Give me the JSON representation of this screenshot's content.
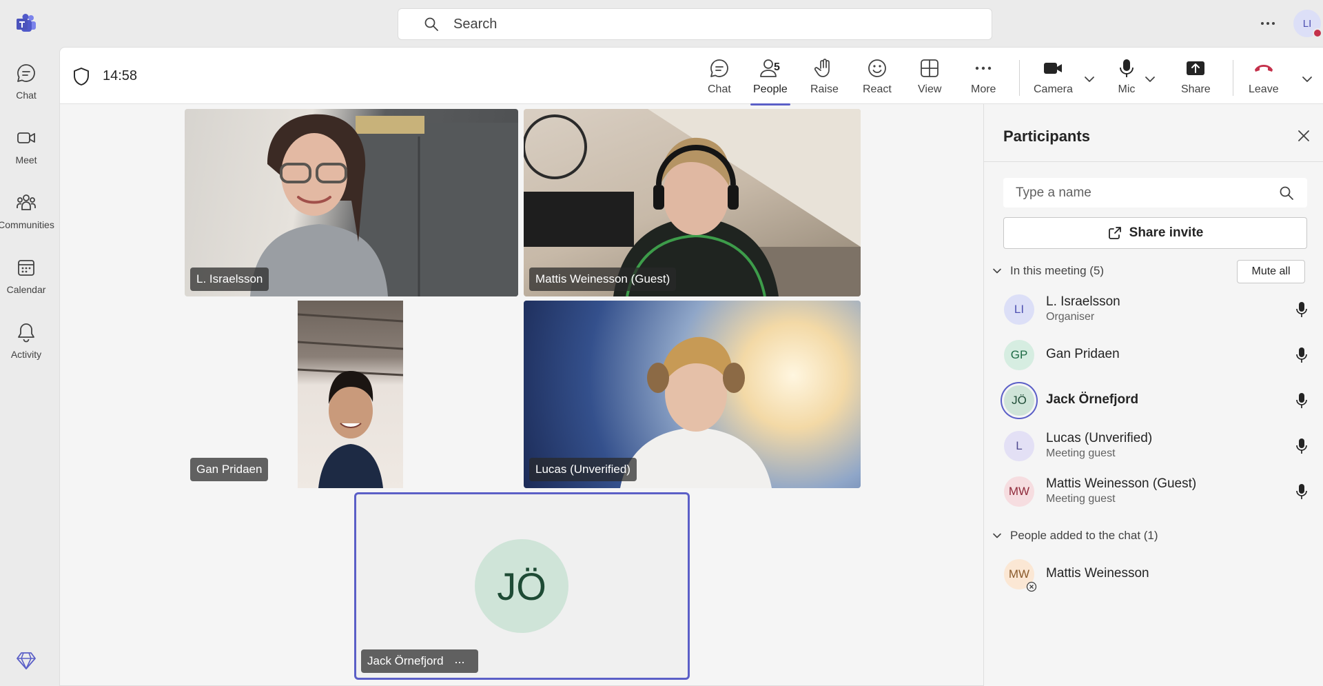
{
  "app": {
    "name": "Microsoft Teams"
  },
  "search": {
    "placeholder": "Search"
  },
  "user": {
    "initials": "LI",
    "status_color": "#c4314b"
  },
  "rail": {
    "items": [
      {
        "label": "Chat",
        "icon": "chat-icon"
      },
      {
        "label": "Meet",
        "icon": "video-camera-icon"
      },
      {
        "label": "Communities",
        "icon": "communities-icon"
      },
      {
        "label": "Calendar",
        "icon": "calendar-icon"
      },
      {
        "label": "Activity",
        "icon": "bell-icon"
      }
    ],
    "bottom_icon": "premium-diamond-icon"
  },
  "meeting": {
    "timer": "14:58",
    "toolbar": {
      "chat": "Chat",
      "people": "People",
      "people_count": "5",
      "raise": "Raise",
      "react": "React",
      "view": "View",
      "more": "More",
      "camera": "Camera",
      "mic": "Mic",
      "share": "Share",
      "leave": "Leave"
    },
    "accent_color": "#5b5fc7",
    "leave_color": "#c4314b",
    "tiles": [
      {
        "name": "L. Israelsson"
      },
      {
        "name": "Mattis Weinesson (Guest)"
      },
      {
        "name": "Gan Pridaen"
      },
      {
        "name": "Lucas (Unverified)"
      },
      {
        "name": "Jack Örnefjord",
        "initials": "JÖ",
        "more": "···"
      }
    ]
  },
  "panel": {
    "title": "Participants",
    "search_placeholder": "Type a name",
    "share_invite": "Share invite",
    "in_meeting_label": "In this meeting (5)",
    "mute_all": "Mute all",
    "participants": [
      {
        "initials": "LI",
        "name": "L. Israelsson",
        "role": "Organiser"
      },
      {
        "initials": "GP",
        "name": "Gan Pridaen",
        "role": ""
      },
      {
        "initials": "JÖ",
        "name": "Jack Örnefjord",
        "role": ""
      },
      {
        "initials": "L",
        "name": "Lucas (Unverified)",
        "role": "Meeting guest"
      },
      {
        "initials": "MW",
        "name": "Mattis Weinesson (Guest)",
        "role": "Meeting guest"
      }
    ],
    "added_label": "People added to the chat (1)",
    "added": [
      {
        "initials": "MW",
        "name": "Mattis Weinesson"
      }
    ]
  }
}
